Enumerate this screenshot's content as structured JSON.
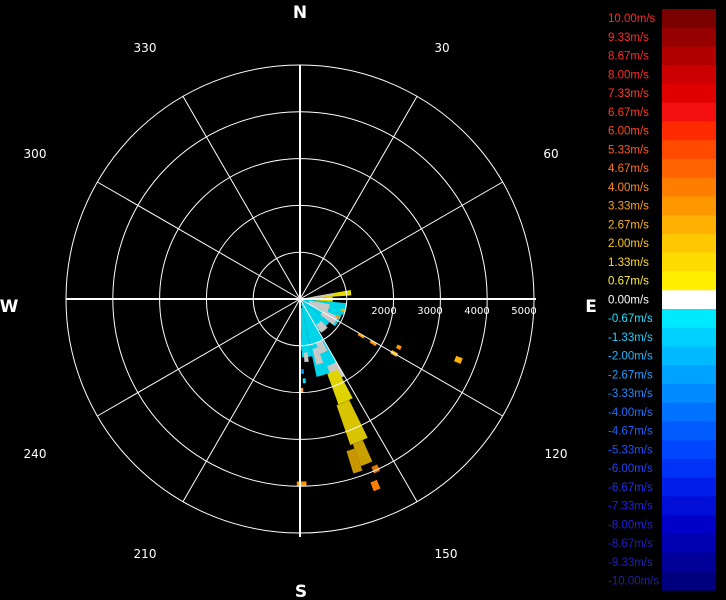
{
  "chart_data": {
    "type": "polar-heatmap",
    "title": "",
    "cardinal_labels": {
      "north": "N",
      "east": "E",
      "south": "S",
      "west": "W"
    },
    "degree_labels": [
      "30",
      "60",
      "120",
      "150",
      "210",
      "240",
      "300",
      "330"
    ],
    "range_ticks": [
      "2000",
      "3000",
      "4000",
      "5000"
    ],
    "range_max": 5000,
    "grid": true,
    "legend_position": "right",
    "legend": [
      {
        "label": "10.00m/s",
        "color": "#7a0000",
        "text_color": "#ff2a2a"
      },
      {
        "label": "9.33m/s",
        "color": "#950000",
        "text_color": "#ff2a2a"
      },
      {
        "label": "8.67m/s",
        "color": "#b00000",
        "text_color": "#ff2a2a"
      },
      {
        "label": "8.00m/s",
        "color": "#cc0000",
        "text_color": "#ff2a2a"
      },
      {
        "label": "7.33m/s",
        "color": "#e00000",
        "text_color": "#ff3a2a"
      },
      {
        "label": "6.67m/s",
        "color": "#f51010",
        "text_color": "#ff3a2a"
      },
      {
        "label": "6.00m/s",
        "color": "#ff2a00",
        "text_color": "#ff4a20"
      },
      {
        "label": "5.33m/s",
        "color": "#ff4a00",
        "text_color": "#ff5a20"
      },
      {
        "label": "4.67m/s",
        "color": "#ff6400",
        "text_color": "#ff7020"
      },
      {
        "label": "4.00m/s",
        "color": "#ff7e00",
        "text_color": "#ff8a20"
      },
      {
        "label": "3.33m/s",
        "color": "#ff9800",
        "text_color": "#ffa020"
      },
      {
        "label": "2.67m/s",
        "color": "#ffb000",
        "text_color": "#ffb420"
      },
      {
        "label": "2.00m/s",
        "color": "#ffc800",
        "text_color": "#ffc820"
      },
      {
        "label": "1.33m/s",
        "color": "#ffdc00",
        "text_color": "#ffdc20"
      },
      {
        "label": "0.67m/s",
        "color": "#ffee00",
        "text_color": "#ffee40"
      },
      {
        "label": "0.00m/s",
        "color": "#ffffff",
        "text_color": "#ffffff"
      },
      {
        "label": "-0.67m/s",
        "color": "#00eaff",
        "text_color": "#20e0ff"
      },
      {
        "label": "-1.33m/s",
        "color": "#00d2ff",
        "text_color": "#20d0ff"
      },
      {
        "label": "-2.00m/s",
        "color": "#00baff",
        "text_color": "#20b8ff"
      },
      {
        "label": "-2.67m/s",
        "color": "#00a2ff",
        "text_color": "#20a0ff"
      },
      {
        "label": "-3.33m/s",
        "color": "#008aff",
        "text_color": "#2088ff"
      },
      {
        "label": "-4.00m/s",
        "color": "#0072ff",
        "text_color": "#2070ff"
      },
      {
        "label": "-4.67m/s",
        "color": "#005cff",
        "text_color": "#2060ff"
      },
      {
        "label": "-5.33m/s",
        "color": "#0046ff",
        "text_color": "#2050ff"
      },
      {
        "label": "-6.00m/s",
        "color": "#0032f5",
        "text_color": "#2040ff"
      },
      {
        "label": "-6.67m/s",
        "color": "#001ee8",
        "text_color": "#2030f0"
      },
      {
        "label": "-7.33m/s",
        "color": "#000ed8",
        "text_color": "#2020e0"
      },
      {
        "label": "-8.00m/s",
        "color": "#0000c8",
        "text_color": "#2020d0"
      },
      {
        "label": "-8.67m/s",
        "color": "#0000b0",
        "text_color": "#2020c0"
      },
      {
        "label": "-9.33m/s",
        "color": "#000098",
        "text_color": "#2020b0"
      },
      {
        "label": "-10.00m/s",
        "color": "#00007e",
        "text_color": "#2020a0"
      }
    ],
    "cells": [
      {
        "az": 80,
        "a2": 86,
        "r1": 0,
        "r2": 1100,
        "color": "#e6dc00"
      },
      {
        "az": 86,
        "a2": 95,
        "r1": 0,
        "r2": 700,
        "color": "#e6dc00"
      },
      {
        "az": 80,
        "a2": 84,
        "r1": 300,
        "r2": 700,
        "color": "#c8c8c8"
      },
      {
        "az": 95,
        "a2": 110,
        "r1": 0,
        "r2": 1000,
        "color": "#00d4e8"
      },
      {
        "az": 110,
        "a2": 128,
        "r1": 0,
        "r2": 950,
        "color": "#00d4e8"
      },
      {
        "az": 128,
        "a2": 150,
        "r1": 0,
        "r2": 800,
        "color": "#00d4e8"
      },
      {
        "az": 150,
        "a2": 168,
        "r1": 100,
        "r2": 1700,
        "color": "#00d4e8"
      },
      {
        "az": 168,
        "a2": 178,
        "r1": 200,
        "r2": 1250,
        "color": "#00d4e8"
      },
      {
        "az": 178,
        "a2": 180,
        "r1": 250,
        "r2": 1100,
        "color": "#00d4e8"
      },
      {
        "az": 100,
        "a2": 118,
        "r1": 200,
        "r2": 650,
        "color": "#c8c8c8"
      },
      {
        "az": 115,
        "a2": 128,
        "r1": 550,
        "r2": 900,
        "color": "#c8c8c8"
      },
      {
        "az": 136,
        "a2": 148,
        "r1": 650,
        "r2": 850,
        "color": "#c8c8c8"
      },
      {
        "az": 152,
        "a2": 160,
        "r1": 1000,
        "r2": 1250,
        "color": "#c8c8c8"
      },
      {
        "az": 160,
        "a2": 166,
        "r1": 1100,
        "r2": 1450,
        "color": "#c8c8c8"
      },
      {
        "az": 172,
        "a2": 176,
        "r1": 1150,
        "r2": 1350,
        "color": "#c8c8c8"
      },
      {
        "az": 150,
        "a2": 158,
        "r1": 1550,
        "r2": 1900,
        "color": "#c8c8c8"
      },
      {
        "az": 152,
        "a2": 160,
        "r1": 1700,
        "r2": 2400,
        "color": "#e0d400"
      },
      {
        "az": 154,
        "a2": 161,
        "r1": 2400,
        "r2": 3300,
        "color": "#d8c400"
      },
      {
        "az": 156,
        "a2": 160,
        "r1": 3300,
        "r2": 3800,
        "color": "#c8a000"
      },
      {
        "az": 160,
        "a2": 163,
        "r1": 3400,
        "r2": 3900,
        "color": "#c89600"
      },
      {
        "az": 155,
        "a2": 157,
        "r1": 3900,
        "r2": 4050,
        "color": "#e07800"
      },
      {
        "az": 120,
        "a2": 122,
        "r1": 1450,
        "r2": 1600,
        "color": "#ff9800"
      },
      {
        "az": 120,
        "a2": 122,
        "r1": 1750,
        "r2": 1900,
        "color": "#ff9800"
      },
      {
        "az": 119,
        "a2": 121,
        "r1": 2250,
        "r2": 2400,
        "color": "#ffb000"
      },
      {
        "az": 115,
        "a2": 117,
        "r1": 2300,
        "r2": 2400,
        "color": "#ff9800"
      },
      {
        "az": 110,
        "a2": 112,
        "r1": 3550,
        "r2": 3700,
        "color": "#ffb000"
      },
      {
        "az": 114,
        "a2": 117,
        "r1": 850,
        "r2": 950,
        "color": "#ff9800"
      },
      {
        "az": 103,
        "a2": 106,
        "r1": 900,
        "r2": 1000,
        "color": "#ffb000"
      },
      {
        "az": 157,
        "a2": 159,
        "r1": 4200,
        "r2": 4400,
        "color": "#ff7e00"
      },
      {
        "az": 178,
        "a2": 181,
        "r1": 3900,
        "r2": 4000,
        "color": "#ff9800"
      },
      {
        "az": 178,
        "a2": 180,
        "r1": 1900,
        "r2": 2000,
        "color": "#ffb000"
      },
      {
        "az": 177,
        "a2": 179,
        "r1": 1500,
        "r2": 1600,
        "color": "#00a2ff"
      },
      {
        "az": 176,
        "a2": 178,
        "r1": 1700,
        "r2": 1800,
        "color": "#00eaff"
      },
      {
        "az": 107,
        "a2": 110,
        "r1": 700,
        "r2": 800,
        "color": "#00eaff"
      }
    ]
  }
}
